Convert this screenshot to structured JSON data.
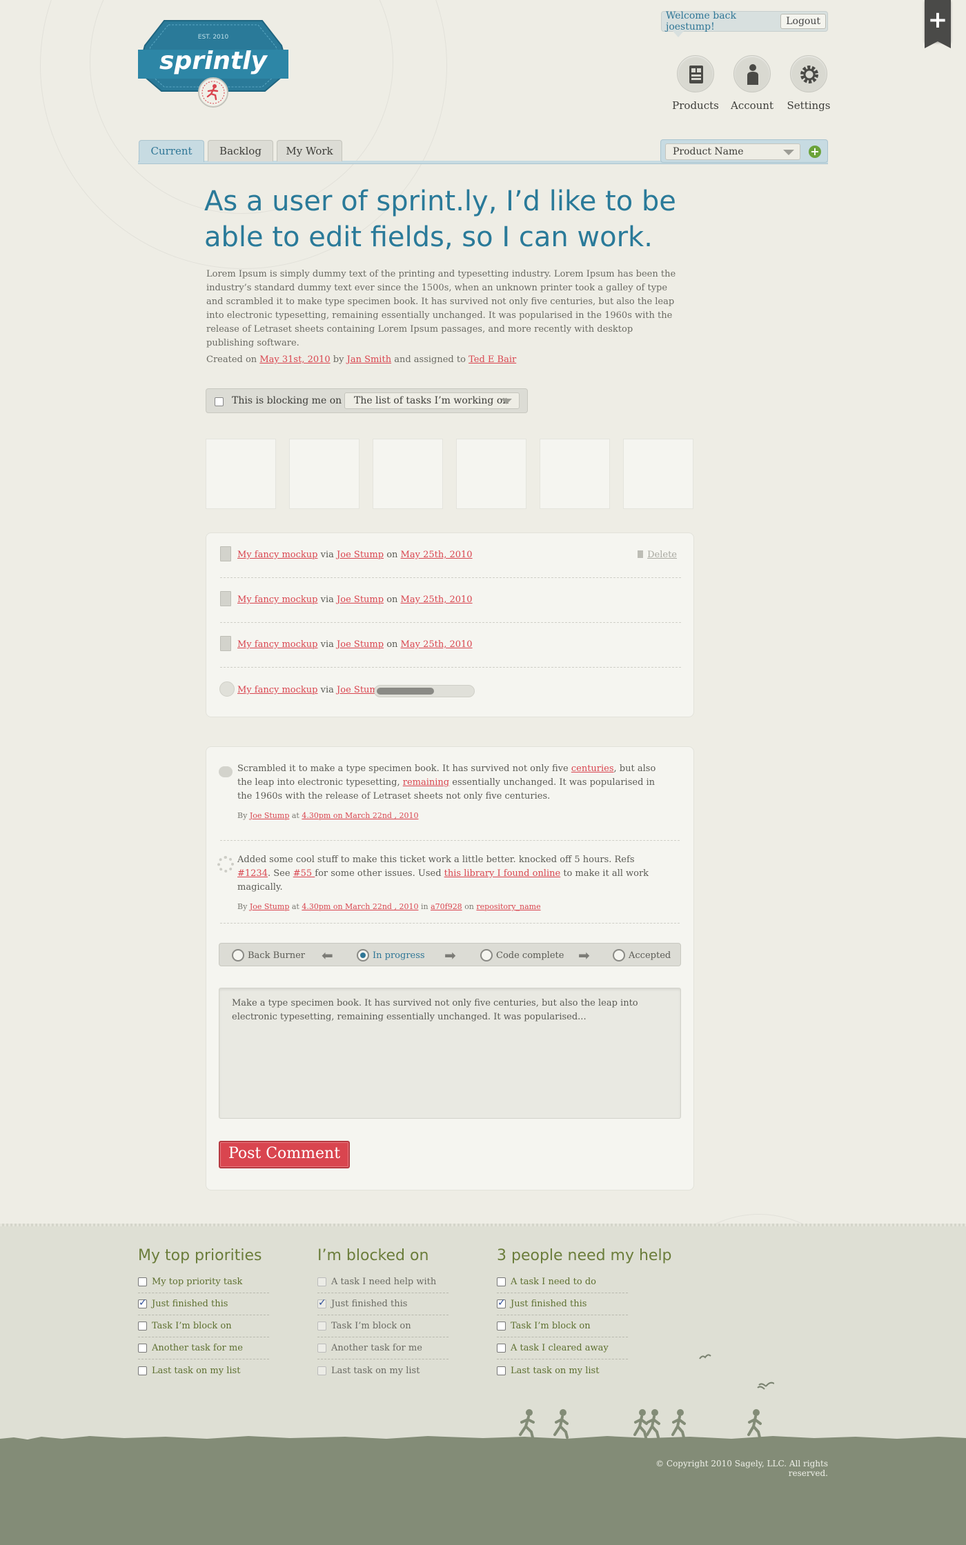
{
  "app": {
    "logo_text": "sprintly",
    "logo_est": "EST. 2010"
  },
  "header": {
    "welcome": "Welcome back joestump!",
    "logout_label": "Logout",
    "nav": [
      {
        "label": "Products",
        "icon": "products-icon"
      },
      {
        "label": "Account",
        "icon": "account-icon"
      },
      {
        "label": "Settings",
        "icon": "gear-icon"
      }
    ],
    "ribbon_label": "+"
  },
  "tabs": [
    {
      "label": "Current",
      "active": true
    },
    {
      "label": "Backlog",
      "active": false
    },
    {
      "label": "My Work",
      "active": false
    }
  ],
  "product_select": {
    "value": "Product Name"
  },
  "story": {
    "title": "As a user of sprint.ly, I’d like to be able to edit fields, so I can work.",
    "description": "Lorem Ipsum is simply dummy text of the printing and typesetting industry. Lorem Ipsum has been the industry’s standard dummy text ever since the 1500s, when an unknown printer took a galley of type and scrambled it to make type specimen book. It has survived not only five centuries, but also the leap into electronic typesetting, remaining essentially unchanged. It was popularised in the 1960s with the release of Letraset sheets containing Lorem Ipsum passages, and more recently with desktop publishing software.",
    "created_prefix": "Created on",
    "created_date": "May 31st, 2010",
    "by_word": "by",
    "author": "Jan Smith",
    "assigned_word": "and assigned to",
    "assignee": "Ted E Bair"
  },
  "blocking": {
    "label": "This is blocking me on",
    "select_value": "The list of tasks I’m working on"
  },
  "files": {
    "delete_label": "Delete",
    "rows": [
      {
        "name": "My fancy mockup",
        "via": "via",
        "user": "Joe Stump",
        "on": "on",
        "date": "May 25th, 2010"
      },
      {
        "name": "My fancy mockup",
        "via": "via",
        "user": "Joe Stump",
        "on": "on",
        "date": "May 25th, 2010"
      },
      {
        "name": "My fancy mockup",
        "via": "via",
        "user": "Joe Stump",
        "on": "on",
        "date": "May 25th, 2010"
      }
    ],
    "uploading": {
      "name": "My fancy mockup",
      "via": "via",
      "user": "Joe Stump",
      "progress": 0.6
    }
  },
  "comments": [
    {
      "t1": "Scrambled it to make a type specimen book. It has survived not only five ",
      "l1": "centuries",
      "t2": ", but also the leap into electronic typesetting, ",
      "l2": "remaining",
      "t3": " essentially unchanged. It was popularised in the 1960s with the release of Letraset sheets not only five centuries.",
      "by": "By",
      "user": "Joe Stump",
      "at": "at",
      "time": "4.30pm on March 22nd , 2010"
    },
    {
      "t1": "Added some cool stuff to make this ticket work a little better. knocked off 5 hours. Refs ",
      "l1": "#1234",
      "t2": ". See ",
      "l2": "#55 ",
      "t3": "for some other issues. Used ",
      "l3": "this library I found online",
      "t4": " to make it all work magically.",
      "by": "By",
      "user": "Joe Stump",
      "at": "at",
      "time": "4.30pm on March 22nd , 2010",
      "in": "in",
      "commit": "a70f928",
      "on": "on",
      "repo": "repository_name"
    }
  ],
  "status": {
    "options": [
      "Back Burner",
      "In progress",
      "Code complete",
      "Accepted"
    ],
    "selected": "In progress",
    "arrow_left": "⬅",
    "arrow_right": "➡"
  },
  "comment_box": {
    "value": "Make a type specimen book. It has survived not only five centuries, but also the leap into electronic typesetting, remaining essentially unchanged. It was popularised..."
  },
  "post_button": "Post Comment",
  "footer": {
    "columns": [
      {
        "title": "My top priorities",
        "items": [
          {
            "label": "My top priority task",
            "checked": false
          },
          {
            "label": "Just finished this",
            "checked": true
          },
          {
            "label": "Task I’m block on",
            "checked": false
          },
          {
            "label": "Another task for me",
            "checked": false
          },
          {
            "label": "Last task on my list",
            "checked": false
          }
        ]
      },
      {
        "title": "I’m blocked on",
        "items": [
          {
            "label": "A task I need help with",
            "checked": false
          },
          {
            "label": "Just finished this",
            "checked": true
          },
          {
            "label": "Task I’m block on",
            "checked": false
          },
          {
            "label": "Another task for me",
            "checked": false
          },
          {
            "label": "Last task on my list",
            "checked": false
          }
        ]
      },
      {
        "title": "3 people need my help",
        "items": [
          {
            "label": "A task I need to do",
            "checked": false
          },
          {
            "label": "Just finished this",
            "checked": true
          },
          {
            "label": "Task I’m block on",
            "checked": false
          },
          {
            "label": "A task I cleared away",
            "checked": false
          },
          {
            "label": "Last task on my list",
            "checked": false
          }
        ]
      }
    ],
    "copyright": "© Copyright 2010 Sagely, LLC. All rights reserved."
  },
  "colors": {
    "brand_blue": "#2a7a99",
    "link_red": "#d9454f",
    "footer_green": "#838c77",
    "accent_olive": "#6b7d3b"
  }
}
